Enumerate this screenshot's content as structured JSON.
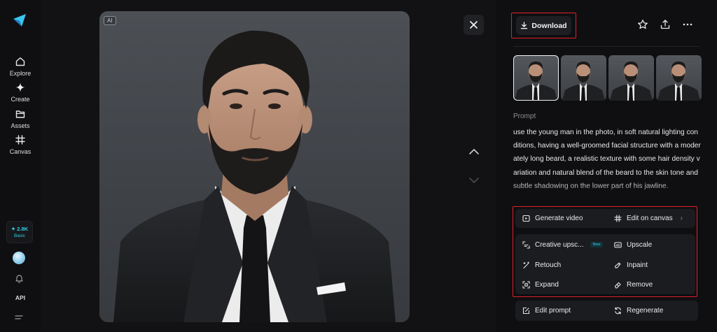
{
  "colors": {
    "accent": "#2fd0e6",
    "highlight_border": "#e0202a",
    "background": "#0f0f11",
    "card": "#1b1c1f"
  },
  "sidebar": {
    "logo_icon": "app-logo-icon",
    "items": [
      {
        "label": "Explore",
        "icon": "home-icon"
      },
      {
        "label": "Create",
        "icon": "sparkle-icon"
      },
      {
        "label": "Assets",
        "icon": "folder-icon"
      },
      {
        "label": "Canvas",
        "icon": "canvas-grid-icon"
      }
    ],
    "credits": {
      "amount": "✦ 2.8K",
      "plan": "Basic"
    },
    "api_label": "API"
  },
  "viewer": {
    "ai_badge": "AI",
    "close_icon": "close-icon"
  },
  "panel": {
    "download_label": "Download",
    "prompt_label": "Prompt",
    "prompt_text": "use the young man in the photo, in soft natural lighting conditions, having a well-groomed facial structure with a moderately long beard, a realistic texture with some hair density variation and natural blend of the beard to the skin tone and subtle shadowing on the lower part of his jawline.",
    "actions": {
      "generate_video": "Generate video",
      "edit_on_canvas": "Edit on canvas",
      "creative_upscale": "Creative upsc...",
      "new_badge": "New",
      "upscale": "Upscale",
      "retouch": "Retouch",
      "inpaint": "Inpaint",
      "expand": "Expand",
      "remove": "Remove",
      "edit_prompt": "Edit prompt",
      "regenerate": "Regenerate"
    }
  }
}
